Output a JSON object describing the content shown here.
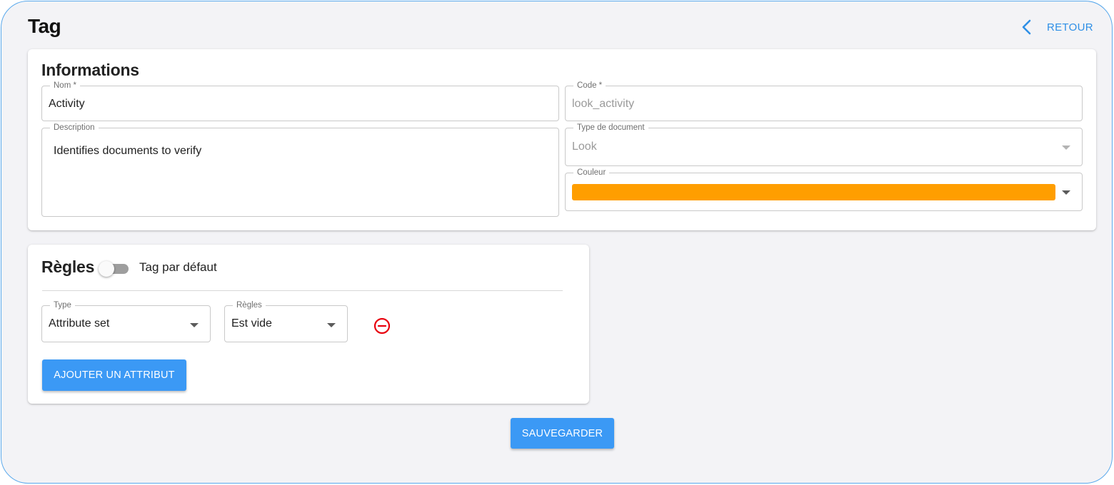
{
  "header": {
    "title": "Tag",
    "back_label": "RETOUR"
  },
  "informations": {
    "title": "Informations",
    "nom": {
      "label": "Nom *",
      "value": "Activity"
    },
    "code": {
      "label": "Code *",
      "value": "look_activity"
    },
    "description": {
      "label": "Description",
      "value": "Identifies documents to verify"
    },
    "type_document": {
      "label": "Type de document",
      "value": "Look"
    },
    "couleur": {
      "label": "Couleur",
      "color": "#ff9e00"
    }
  },
  "regles": {
    "title": "Règles",
    "toggle_label": "Tag par défaut",
    "toggle_on": false,
    "type": {
      "label": "Type",
      "value": "Attribute set"
    },
    "rule": {
      "label": "Règles",
      "value": "Est vide"
    },
    "add_button": "AJOUTER UN ATTRIBUT"
  },
  "save_button": "SAUVEGARDER",
  "colors": {
    "accent": "#3b99f5",
    "danger": "#e8000d",
    "frame": "#5aa9ec"
  }
}
